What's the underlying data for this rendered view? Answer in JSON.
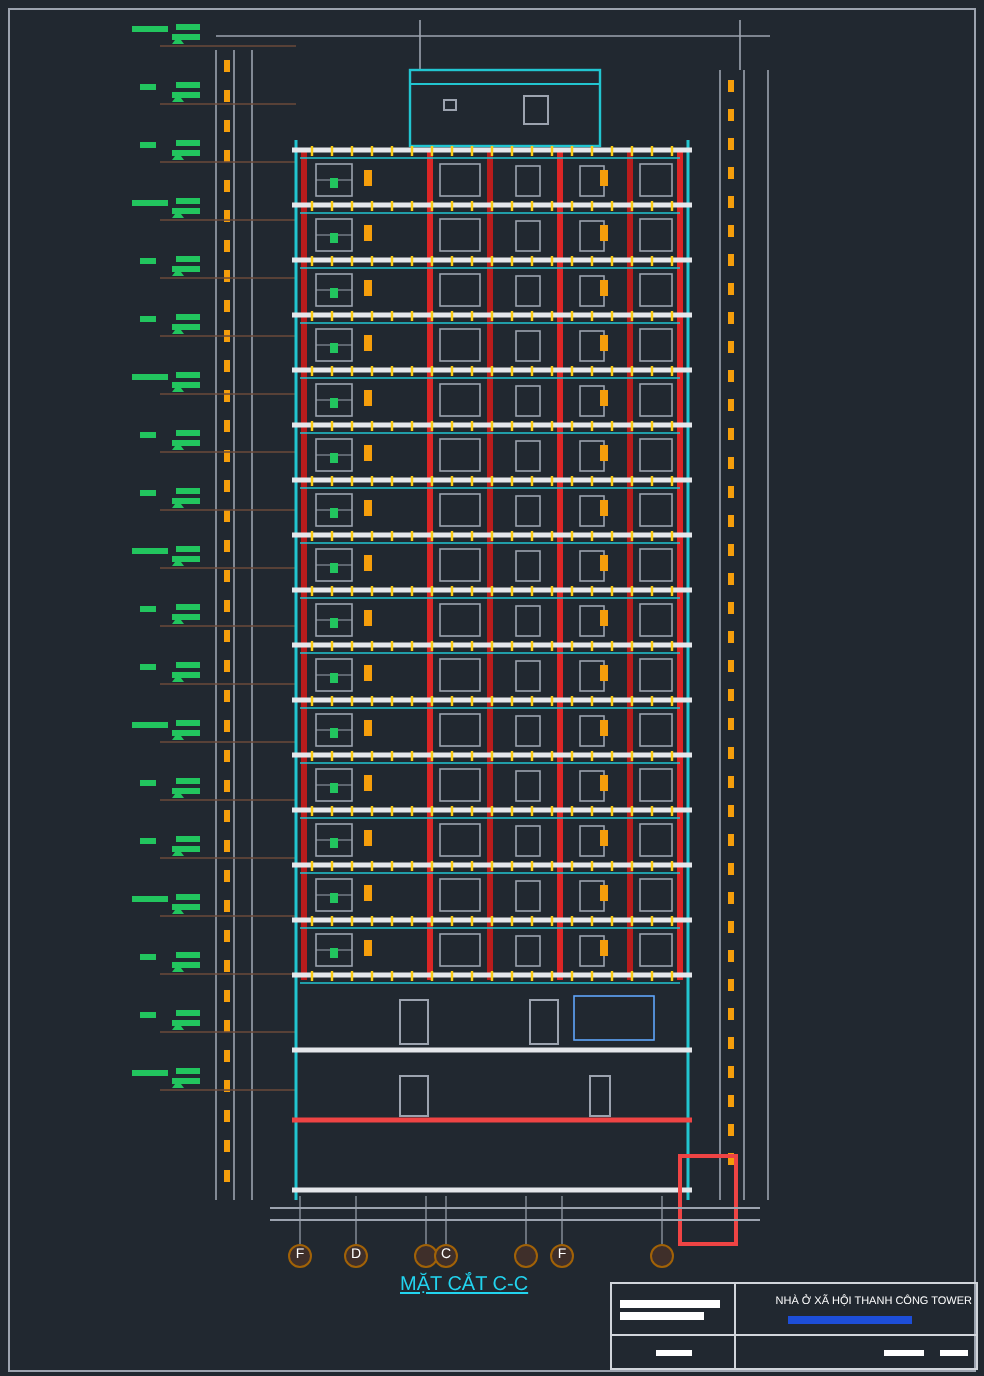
{
  "drawing": {
    "section_title": "MẶT CẮT C-C",
    "grid_bubbles": [
      {
        "label": "F"
      },
      {
        "label": "D"
      },
      {
        "label": "C"
      },
      {
        "label": "F"
      }
    ]
  },
  "title_block": {
    "project_name": "NHÀ Ở XÃ HỘI THANH CÔNG TOWER"
  }
}
